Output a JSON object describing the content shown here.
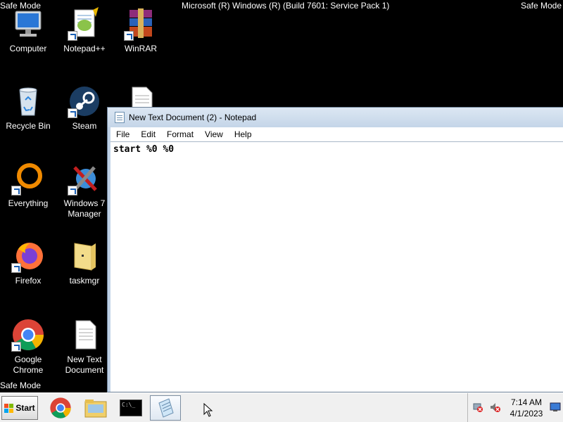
{
  "desktop": {
    "safe_mode_top_left": "Safe Mode",
    "safe_mode_top_right": "Safe Mode",
    "safe_mode_bottom_left": "Safe Mode",
    "build_text": "Microsoft (R) Windows (R) (Build 7601: Service Pack 1)",
    "icons": [
      {
        "label": "Computer",
        "icon": "computer-icon"
      },
      {
        "label": "Notepad++",
        "icon": "notepadpp-icon"
      },
      {
        "label": "WinRAR",
        "icon": "winrar-icon"
      },
      {
        "label": "Recycle Bin",
        "icon": "recycle-bin-icon"
      },
      {
        "label": "Steam",
        "icon": "steam-icon"
      },
      {
        "label": "",
        "icon": "text-document-icon"
      },
      {
        "label": "Everything",
        "icon": "everything-icon"
      },
      {
        "label": "Windows 7 Manager",
        "icon": "windows7-manager-icon"
      },
      {
        "label": "Firefox",
        "icon": "firefox-icon"
      },
      {
        "label": "taskmgr",
        "icon": "folder-icon"
      },
      {
        "label": "Google Chrome",
        "icon": "chrome-icon"
      },
      {
        "label": "New Text Document",
        "icon": "text-document-icon"
      }
    ]
  },
  "notepad": {
    "title": "New Text Document (2) - Notepad",
    "menu": [
      "File",
      "Edit",
      "Format",
      "View",
      "Help"
    ],
    "content": "start %0 %0"
  },
  "taskbar": {
    "start_label": "Start",
    "pinned": [
      {
        "icon": "chrome-icon"
      },
      {
        "icon": "explorer-icon"
      },
      {
        "icon": "cmd-icon",
        "text": "C:\\_"
      },
      {
        "icon": "notepad-icon",
        "active": true
      }
    ],
    "clock_time": "7:14 AM",
    "clock_date": "4/1/2023",
    "tray_icons": [
      "network-disconnected-icon",
      "volume-muted-icon",
      "action-center-icon"
    ]
  },
  "colors": {
    "desktop": "#000000",
    "taskbar": "#f0f0f0",
    "window_frame": "#bfd1e6"
  }
}
